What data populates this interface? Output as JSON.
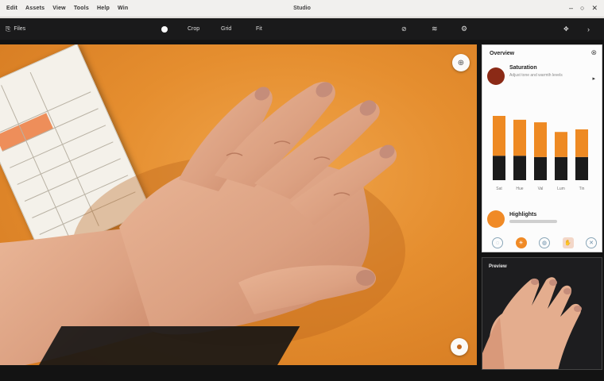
{
  "menubar": {
    "menus": [
      "Edit",
      "Assets",
      "View",
      "Tools",
      "Help",
      "Win"
    ],
    "app_title": "Studio",
    "window_controls": [
      "minimize-icon",
      "maximize-icon",
      "close-icon"
    ]
  },
  "toolbar": {
    "left_label": "Files",
    "center_items": [
      "Crop",
      "Grid",
      "Fit"
    ],
    "right_icons": [
      "search-icon",
      "layers-icon",
      "settings-icon",
      "pin-icon",
      "collapse-icon"
    ]
  },
  "panel": {
    "title": "Overview",
    "row1_title": "Saturation",
    "row1_sub": "Adjust tone and warmth levels",
    "row2_title": "Highlights",
    "icons": [
      "circle-icon",
      "sun-icon",
      "drop-icon",
      "hand-icon",
      "close-icon"
    ]
  },
  "chart_data": {
    "type": "bar",
    "categories": [
      "Sat",
      "Hue",
      "Val",
      "Lum",
      "Tin"
    ],
    "series": [
      {
        "name": "",
        "values": [
          0.62,
          0.56,
          0.54,
          0.39,
          0.43
        ]
      },
      {
        "name": "",
        "values": [
          0.38,
          0.38,
          0.36,
          0.36,
          0.36
        ]
      }
    ],
    "colors": [
      "#ee8a23",
      "#1b1b1b"
    ],
    "ylim": [
      0,
      1
    ]
  },
  "preview": {
    "label": "Preview"
  },
  "colors": {
    "canvas": "#e58e2f",
    "accent": "#f08a26",
    "toolbar": "#1a1a1b"
  }
}
